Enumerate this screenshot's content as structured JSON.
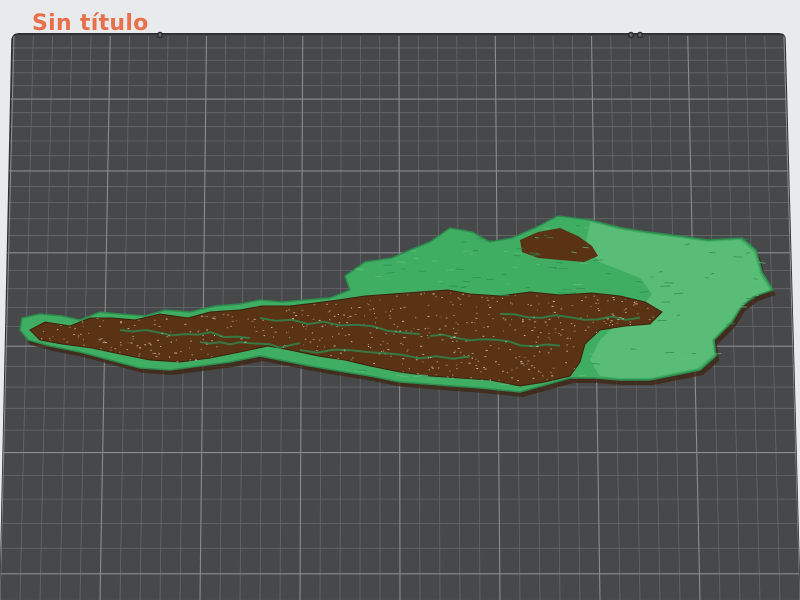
{
  "app": {
    "document_title": "Sin título"
  },
  "colors": {
    "title": "#e8704a",
    "background": "#e9eaeb",
    "plate": "#46484a",
    "plate_edge": "#2f3133",
    "grid_minor": "#66686b",
    "grid_major": "#8a8c8f",
    "terrain_low": "#3fae63",
    "terrain_mid": "#2e8b4e",
    "terrain_light": "#5fbf7a",
    "terrain_high": "#5a3214",
    "terrain_high_shadow": "#3d220d",
    "terrain_peak": "#d9c9b5"
  },
  "icons": {
    "plate_clip_left": "clip-icon",
    "plate_clip_right": "clip-icon"
  }
}
